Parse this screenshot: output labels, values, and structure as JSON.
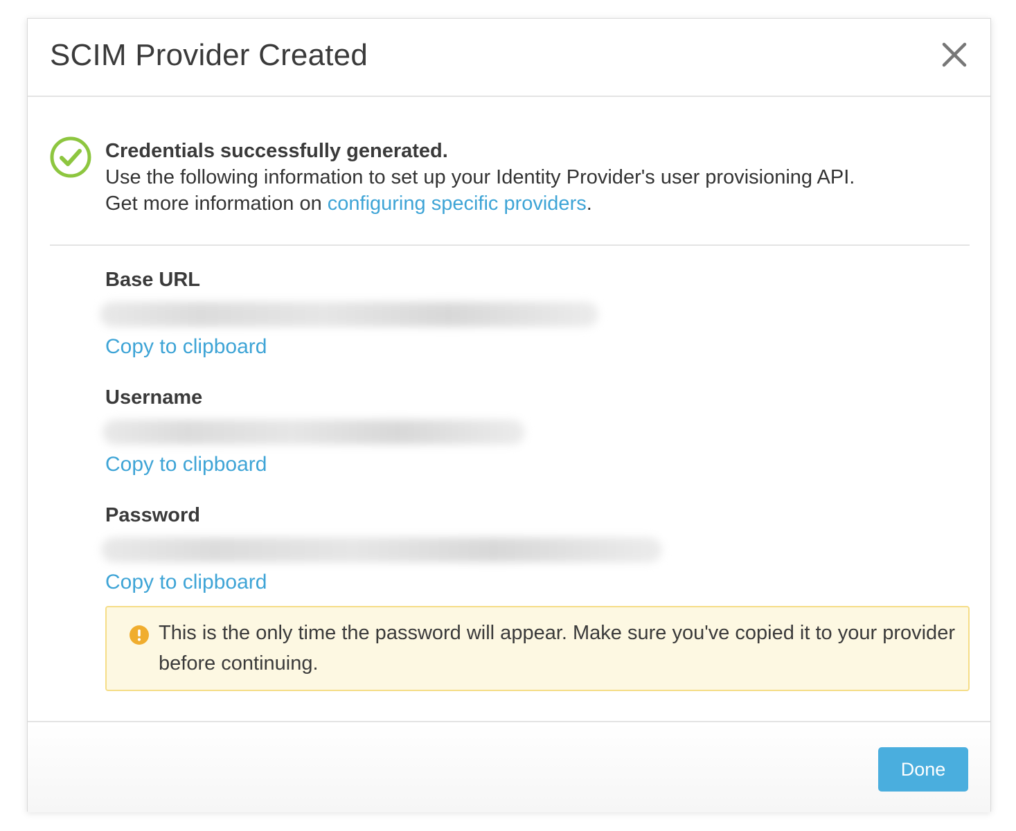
{
  "dialog": {
    "title": "SCIM Provider Created",
    "close_icon": "close-icon"
  },
  "success": {
    "icon": "check-circle-icon",
    "icon_color": "#8dc63f",
    "title": "Credentials successfully generated.",
    "line1": "Use the following information to set up your Identity Provider's user provisioning API.",
    "line2_prefix": "Get more information on ",
    "line2_link": "configuring specific providers",
    "line2_suffix": "."
  },
  "fields": [
    {
      "label": "Base URL",
      "copy_label": "Copy to clipboard"
    },
    {
      "label": "Username",
      "copy_label": "Copy to clipboard"
    },
    {
      "label": "Password",
      "copy_label": "Copy to clipboard"
    }
  ],
  "warning": {
    "icon": "exclamation-circle-icon",
    "icon_color": "#f0ad2e",
    "text": "This is the only time the password will appear. Make sure you've copied it to your provider before continuing."
  },
  "footer": {
    "done_label": "Done",
    "accent_color": "#4aaede"
  },
  "link_color": "#3ea4d6"
}
